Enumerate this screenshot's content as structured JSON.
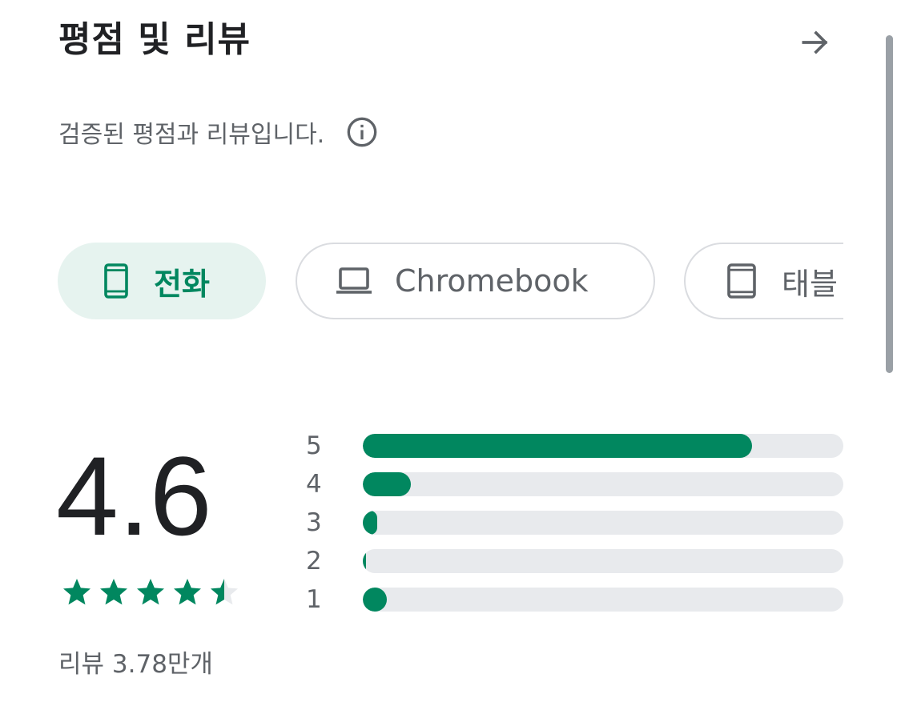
{
  "header": {
    "title": "평점 및 리뷰",
    "arrow_icon": "arrow-forward-icon"
  },
  "subtitle": {
    "text": "검증된 평점과 리뷰입니다.",
    "info_icon": "info-icon"
  },
  "device_chips": [
    {
      "label": "전화",
      "icon": "phone-icon",
      "selected": true
    },
    {
      "label": "Chromebook",
      "icon": "laptop-icon",
      "selected": false
    },
    {
      "label": "태블",
      "icon": "tablet-icon",
      "selected": false
    }
  ],
  "summary": {
    "rating": "4.6",
    "stars_filled": 4.6,
    "review_count": "리뷰 3.78만개"
  },
  "histogram": [
    {
      "label": "5",
      "fraction": 0.81
    },
    {
      "label": "4",
      "fraction": 0.1
    },
    {
      "label": "3",
      "fraction": 0.03
    },
    {
      "label": "2",
      "fraction": 0.006
    },
    {
      "label": "1",
      "fraction": 0.05
    }
  ],
  "colors": {
    "accent": "#01875f",
    "chip_selected_bg": "#e6f3ef",
    "track": "#e8eaed",
    "muted_text": "#5f6368",
    "chip_border": "#dadce0"
  }
}
